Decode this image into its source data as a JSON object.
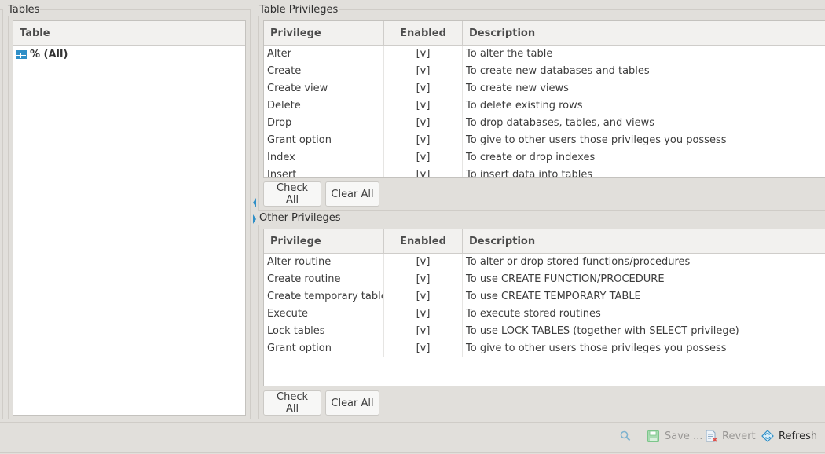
{
  "tables_panel": {
    "legend": "Tables",
    "column_header": "Table",
    "items": [
      {
        "icon": "table-icon",
        "label": "% (All)"
      }
    ]
  },
  "table_privileges": {
    "legend": "Table Privileges",
    "headers": {
      "privilege": "Privilege",
      "enabled": "Enabled",
      "description": "Description"
    },
    "rows": [
      {
        "privilege": "Alter",
        "enabled": "[v]",
        "description": "To alter the table"
      },
      {
        "privilege": "Create",
        "enabled": "[v]",
        "description": "To create new databases and tables"
      },
      {
        "privilege": "Create view",
        "enabled": "[v]",
        "description": "To create new views"
      },
      {
        "privilege": "Delete",
        "enabled": "[v]",
        "description": "To delete existing rows"
      },
      {
        "privilege": "Drop",
        "enabled": "[v]",
        "description": "To drop databases, tables, and views"
      },
      {
        "privilege": "Grant option",
        "enabled": "[v]",
        "description": "To give to other users those privileges you possess"
      },
      {
        "privilege": "Index",
        "enabled": "[v]",
        "description": "To create or drop indexes"
      },
      {
        "privilege": "Insert",
        "enabled": "[v]",
        "description": "To insert data into tables"
      }
    ],
    "check_all": "Check All",
    "clear_all": "Clear All"
  },
  "other_privileges": {
    "legend": "Other Privileges",
    "headers": {
      "privilege": "Privilege",
      "enabled": "Enabled",
      "description": "Description"
    },
    "rows": [
      {
        "privilege": "Alter routine",
        "enabled": "[v]",
        "description": "To alter or drop stored functions/procedures"
      },
      {
        "privilege": "Create routine",
        "enabled": "[v]",
        "description": "To use CREATE FUNCTION/PROCEDURE"
      },
      {
        "privilege": "Create temporary tables",
        "enabled": "[v]",
        "description": "To use CREATE TEMPORARY TABLE"
      },
      {
        "privilege": "Execute",
        "enabled": "[v]",
        "description": "To execute stored routines"
      },
      {
        "privilege": "Lock tables",
        "enabled": "[v]",
        "description": "To use LOCK TABLES (together with SELECT privilege)"
      },
      {
        "privilege": "Grant option",
        "enabled": "[v]",
        "description": "To give to other users those privileges you possess"
      }
    ],
    "check_all": "Check All",
    "clear_all": "Clear All"
  },
  "toolbar": {
    "search_icon": "search-icon",
    "save_label": "Save ...",
    "revert_label": "Revert",
    "refresh_label": "Refresh"
  },
  "colors": {
    "accent": "#2f8fc7",
    "save_icon": "#7cc58a",
    "revert_x": "#e0504a"
  }
}
